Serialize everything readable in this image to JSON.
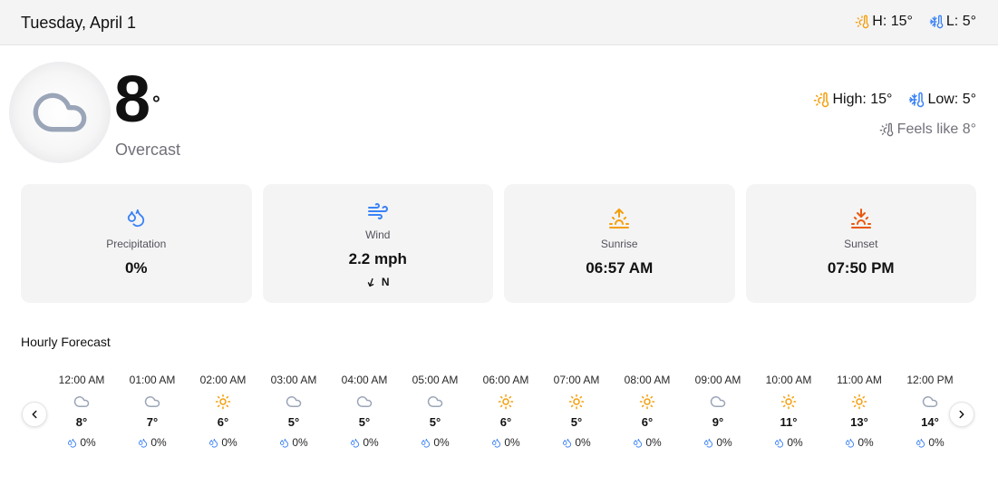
{
  "header": {
    "date": "Tuesday, April 1",
    "high": "H: 15°",
    "low": "L: 5°"
  },
  "current": {
    "temp": "8",
    "degree": "°",
    "condition": "Overcast",
    "icon": "cloud-icon",
    "high": "High: 15°",
    "low": "Low: 5°",
    "feels_like": "Feels like 8°"
  },
  "cards": {
    "precipitation": {
      "label": "Precipitation",
      "value": "0%",
      "icon": "droplets-icon"
    },
    "wind": {
      "label": "Wind",
      "value": "2.2 mph",
      "direction": "N",
      "icon": "wind-icon"
    },
    "sunrise": {
      "label": "Sunrise",
      "value": "06:57 AM",
      "icon": "sunrise-icon"
    },
    "sunset": {
      "label": "Sunset",
      "value": "07:50 PM",
      "icon": "sunset-icon"
    }
  },
  "hourly": {
    "title": "Hourly Forecast",
    "items": [
      {
        "time": "12:00 AM",
        "icon": "cloud",
        "temp": "8°",
        "precip": "0%"
      },
      {
        "time": "01:00 AM",
        "icon": "cloud",
        "temp": "7°",
        "precip": "0%"
      },
      {
        "time": "02:00 AM",
        "icon": "sun",
        "temp": "6°",
        "precip": "0%"
      },
      {
        "time": "03:00 AM",
        "icon": "cloud",
        "temp": "5°",
        "precip": "0%"
      },
      {
        "time": "04:00 AM",
        "icon": "cloud",
        "temp": "5°",
        "precip": "0%"
      },
      {
        "time": "05:00 AM",
        "icon": "cloud",
        "temp": "5°",
        "precip": "0%"
      },
      {
        "time": "06:00 AM",
        "icon": "sun",
        "temp": "6°",
        "precip": "0%"
      },
      {
        "time": "07:00 AM",
        "icon": "sun",
        "temp": "5°",
        "precip": "0%"
      },
      {
        "time": "08:00 AM",
        "icon": "sun",
        "temp": "6°",
        "precip": "0%"
      },
      {
        "time": "09:00 AM",
        "icon": "cloud",
        "temp": "9°",
        "precip": "0%"
      },
      {
        "time": "10:00 AM",
        "icon": "sun",
        "temp": "11°",
        "precip": "0%"
      },
      {
        "time": "11:00 AM",
        "icon": "sun",
        "temp": "13°",
        "precip": "0%"
      },
      {
        "time": "12:00 PM",
        "icon": "cloud",
        "temp": "14°",
        "precip": "0%"
      }
    ]
  },
  "colors": {
    "accent_orange": "#f59e0b",
    "accent_blue": "#3b82f6",
    "cloud_gray": "#9aa5b8",
    "muted_text": "#71717a"
  }
}
